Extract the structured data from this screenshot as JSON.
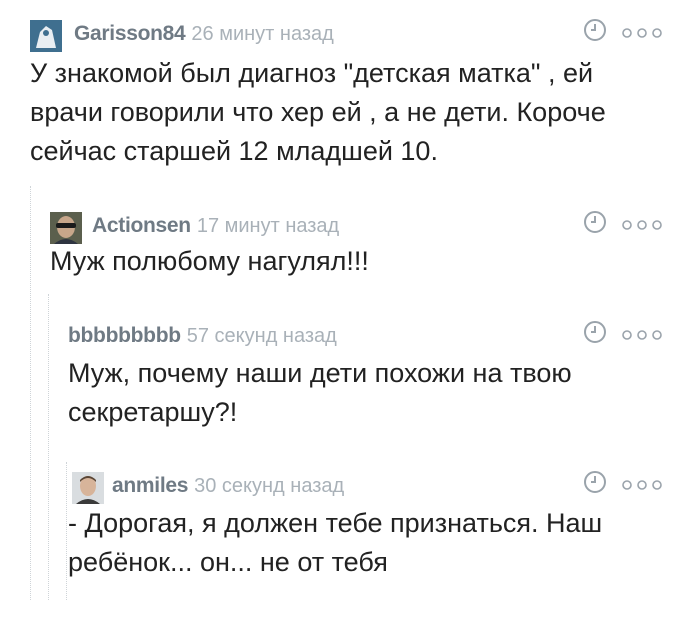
{
  "comments": [
    {
      "author": "Garisson84",
      "time": "26 минут назад",
      "text": "У знакомой был диагноз \"детская матка\" , ей врачи говорили что хер ей , а не дети. Короче сейчас старшей 12 младшей 10."
    },
    {
      "author": "Actionsen",
      "time": "17 минут назад",
      "text": "Муж полюбому нагулял!!!"
    },
    {
      "author": "bbbbbbbbb",
      "time": "57 секунд назад",
      "text": "Муж, почему наши дети похожи на твою секретаршу?!"
    },
    {
      "author": "anmiles",
      "time": "30 секунд назад",
      "text": "- Дорогая, я должен тебе признаться. Наш ребёнок... он... не от тебя"
    }
  ],
  "icons": {
    "clock": "clock-icon",
    "more": "more-options-icon"
  },
  "colors": {
    "author": "#6f7a84",
    "time": "#a9b1b8",
    "text": "#222222",
    "icon": "#9aa3ab"
  }
}
